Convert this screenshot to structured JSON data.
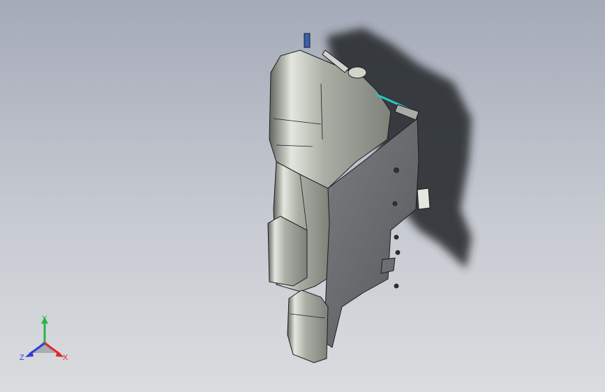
{
  "viewport": {
    "name": "3d-graphics-area",
    "background_top": "#a4aab8",
    "background_bottom": "#dadcdf"
  },
  "model": {
    "body_color": "#8d938a",
    "body_highlight": "#e4e7df",
    "panel_color": "#6c6e73",
    "edge_color": "#1a1c1e",
    "shadow_color": "#2a2d33",
    "accent_color": "#29c7c3"
  },
  "triad": {
    "x_label": "X",
    "y_label": "Y",
    "z_label": "Z",
    "x_color": "#e2262b",
    "y_color": "#2bb34a",
    "z_color": "#2a3fd6"
  }
}
